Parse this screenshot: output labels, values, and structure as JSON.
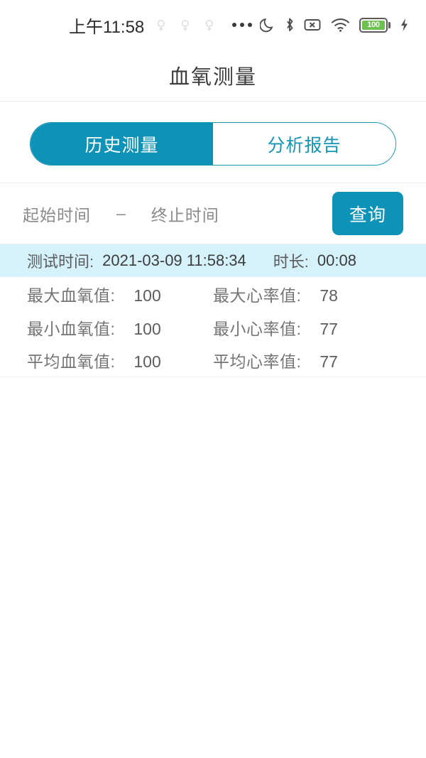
{
  "statusbar": {
    "time": "上午11:58",
    "notification_icons": [
      "notification-dot-icon",
      "notification-dot-icon",
      "notification-dot-icon"
    ],
    "overflow_icon": "more-dots-icon",
    "right_icons": [
      "do-not-disturb-moon-icon",
      "bluetooth-icon",
      "no-sim-icon",
      "wifi-icon",
      "battery-icon",
      "charging-bolt-icon"
    ],
    "battery_level": "100"
  },
  "header": {
    "title": "血氧测量"
  },
  "tabs": [
    {
      "label": "历史测量",
      "active": true
    },
    {
      "label": "分析报告",
      "active": false
    }
  ],
  "filter": {
    "start_placeholder": "起始时间",
    "separator": "–",
    "end_placeholder": "终止时间",
    "query_label": "查询"
  },
  "record": {
    "time_label": "测试时间:",
    "time_value": "2021-03-09 11:58:34",
    "duration_label": "时长:",
    "duration_value": "00:08",
    "rows": [
      {
        "left_label": "最大血氧值:",
        "left_value": "100",
        "right_label": "最大心率值:",
        "right_value": "78"
      },
      {
        "left_label": "最小血氧值:",
        "left_value": "100",
        "right_label": "最小心率值:",
        "right_value": "77"
      },
      {
        "left_label": "平均血氧值:",
        "left_value": "100",
        "right_label": "平均心率值:",
        "right_value": "77"
      }
    ]
  },
  "colors": {
    "accent": "#0d93b7",
    "accent_border": "#1595b6",
    "highlight_row": "#d5f1fa",
    "battery_green": "#6dc14f"
  }
}
